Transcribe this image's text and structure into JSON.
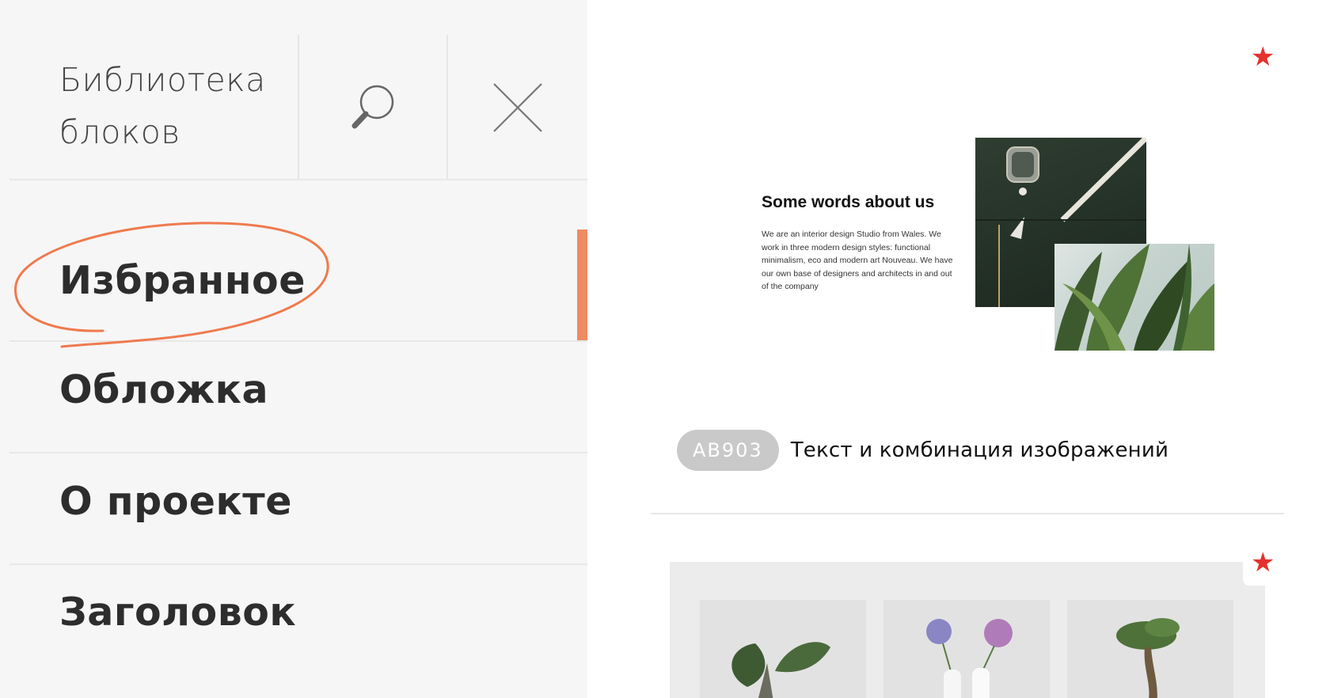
{
  "sidebar": {
    "title": "Библиотека блоков",
    "search_icon": "search-icon",
    "close_icon": "close-icon",
    "items": [
      {
        "label": "Избранное",
        "active": true
      },
      {
        "label": "Обложка"
      },
      {
        "label": "О проекте"
      },
      {
        "label": "Заголовок"
      }
    ],
    "accent_color": "#ef8a62"
  },
  "main": {
    "blocks": [
      {
        "favorite_icon": "star-icon",
        "preview": {
          "heading": "Some words about us",
          "text": "We are an interior design Studio from Wales. We work in three modern design styles: functional minimalism, eco and modern art Nouveau. We have our own base of designers and architects in and out of the company"
        },
        "code": "AB903",
        "name": "Текст и комбинация изображений"
      },
      {
        "favorite_icon": "star-icon"
      }
    ],
    "star_color": "#e5312d"
  }
}
